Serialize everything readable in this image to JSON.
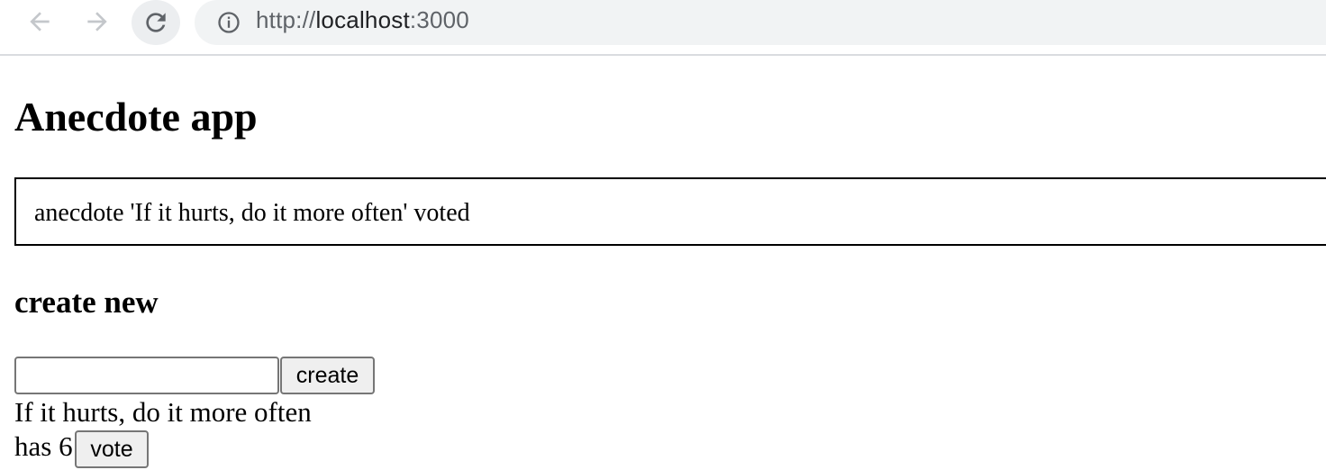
{
  "browser": {
    "url_scheme": "http://",
    "url_host": "localhost",
    "url_port": ":3000"
  },
  "page": {
    "title": "Anecdote app",
    "notification": "anecdote 'If it hurts, do it more often' voted",
    "form": {
      "heading": "create new",
      "input_value": "",
      "create_label": "create"
    },
    "anecdotes": [
      {
        "content": "If it hurts, do it more often",
        "votes_text": "has 6",
        "vote_label": "vote"
      }
    ]
  },
  "colors": {
    "chrome_icon": "#5f6368",
    "omnibox_bg": "#f1f3f4",
    "border": "#000000"
  }
}
